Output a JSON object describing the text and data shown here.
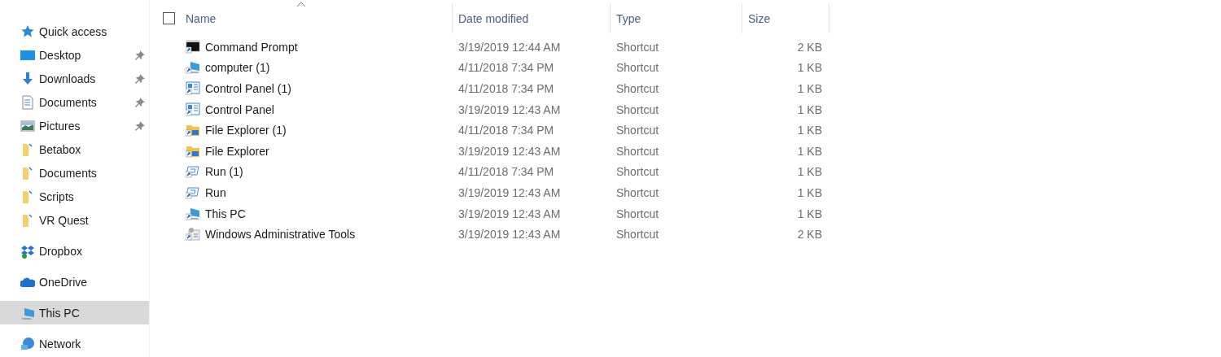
{
  "sidebar": {
    "sections": [
      {
        "label": "Quick access",
        "kind": "star",
        "selected": false,
        "children": [
          {
            "label": "Desktop",
            "kind": "desktop",
            "pinned": true,
            "selected": false
          },
          {
            "label": "Downloads",
            "kind": "download",
            "pinned": true,
            "selected": false
          },
          {
            "label": "Documents",
            "kind": "document",
            "pinned": true,
            "selected": false
          },
          {
            "label": "Pictures",
            "kind": "pictures",
            "pinned": true,
            "selected": false
          },
          {
            "label": "Betabox",
            "kind": "folder",
            "pinned": false,
            "selected": false
          },
          {
            "label": "Documents",
            "kind": "folder",
            "pinned": false,
            "selected": false
          },
          {
            "label": "Scripts",
            "kind": "folder",
            "pinned": false,
            "selected": false
          },
          {
            "label": "VR Quest",
            "kind": "folder",
            "pinned": false,
            "selected": false
          }
        ]
      },
      {
        "label": "Dropbox",
        "kind": "dropbox",
        "selected": false
      },
      {
        "label": "OneDrive",
        "kind": "cloud",
        "selected": false
      },
      {
        "label": "This PC",
        "kind": "pc",
        "selected": true
      },
      {
        "label": "Network",
        "kind": "network",
        "selected": false
      }
    ]
  },
  "table": {
    "all_checked": false,
    "columns": [
      "Name",
      "Date modified",
      "Type",
      "Size"
    ],
    "rows": [
      {
        "kind": "console",
        "name": "Command Prompt",
        "date": "3/19/2019 12:44 AM",
        "type": "Shortcut",
        "size": "2 KB"
      },
      {
        "kind": "computer",
        "name": "computer (1)",
        "date": "4/11/2018 7:34 PM",
        "type": "Shortcut",
        "size": "1 KB"
      },
      {
        "kind": "control",
        "name": "Control Panel (1)",
        "date": "4/11/2018 7:34 PM",
        "type": "Shortcut",
        "size": "1 KB"
      },
      {
        "kind": "control",
        "name": "Control Panel",
        "date": "3/19/2019 12:43 AM",
        "type": "Shortcut",
        "size": "1 KB"
      },
      {
        "kind": "explorer",
        "name": "File Explorer (1)",
        "date": "4/11/2018 7:34 PM",
        "type": "Shortcut",
        "size": "1 KB"
      },
      {
        "kind": "explorer",
        "name": "File Explorer",
        "date": "3/19/2019 12:43 AM",
        "type": "Shortcut",
        "size": "1 KB"
      },
      {
        "kind": "run",
        "name": "Run (1)",
        "date": "4/11/2018 7:34 PM",
        "type": "Shortcut",
        "size": "1 KB"
      },
      {
        "kind": "run",
        "name": "Run",
        "date": "3/19/2019 12:43 AM",
        "type": "Shortcut",
        "size": "1 KB"
      },
      {
        "kind": "computer",
        "name": "This PC",
        "date": "3/19/2019 12:43 AM",
        "type": "Shortcut",
        "size": "1 KB"
      },
      {
        "kind": "admin",
        "name": "Windows Administrative Tools",
        "date": "3/19/2019 12:43 AM",
        "type": "Shortcut",
        "size": "2 KB"
      }
    ]
  }
}
